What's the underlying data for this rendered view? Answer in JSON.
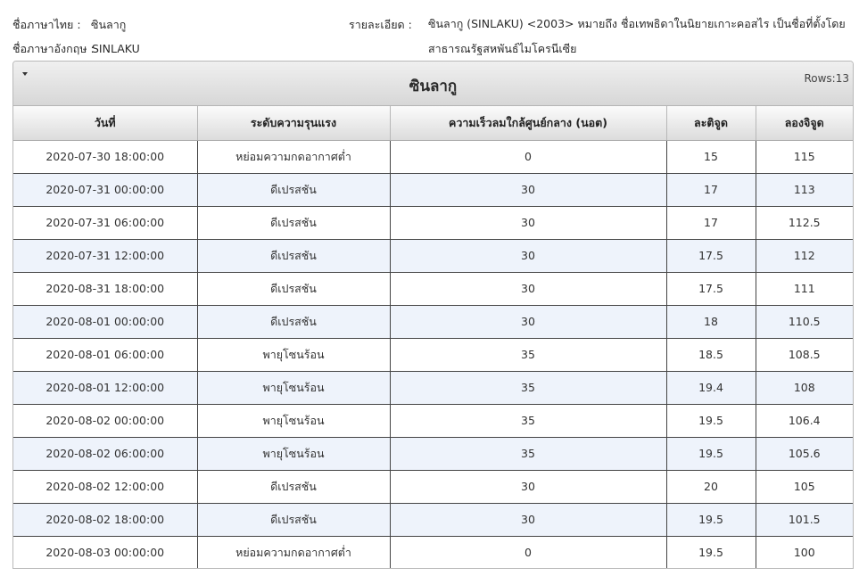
{
  "info": {
    "thai_name_label": "ชื่อภาษาไทย :",
    "thai_name_value": "ซินลากู",
    "english_name_label": "ชื่อภาษาอังกฤษ :",
    "english_name_value": "SINLAKU",
    "detail_label": "รายละเอียด :",
    "detail_value": "ซินลากู (SINLAKU) <2003> หมายถึง ชื่อเทพธิดาในนิยายเกาะคอสไร เป็นชื่อที่ตั้งโดยสาธารณรัฐสหพันธ์ไมโครนีเซีย"
  },
  "grid": {
    "caption": "ซินลากู",
    "rows_label": "Rows:13",
    "collapse_icon": "caret-down-icon",
    "columns": [
      "วันที่",
      "ระดับความรุนแรง",
      "ความเร็วลมใกล้ศูนย์กลาง (นอต)",
      "ละติจูด",
      "ลองจิจูด"
    ],
    "rows": [
      [
        "2020-07-30 18:00:00",
        "หย่อมความกดอากาศต่ำ",
        "0",
        "15",
        "115"
      ],
      [
        "2020-07-31 00:00:00",
        "ดีเปรสชัน",
        "30",
        "17",
        "113"
      ],
      [
        "2020-07-31 06:00:00",
        "ดีเปรสชัน",
        "30",
        "17",
        "112.5"
      ],
      [
        "2020-07-31 12:00:00",
        "ดีเปรสชัน",
        "30",
        "17.5",
        "112"
      ],
      [
        "2020-08-31 18:00:00",
        "ดีเปรสชัน",
        "30",
        "17.5",
        "111"
      ],
      [
        "2020-08-01 00:00:00",
        "ดีเปรสชัน",
        "30",
        "18",
        "110.5"
      ],
      [
        "2020-08-01 06:00:00",
        "พายุโซนร้อน",
        "35",
        "18.5",
        "108.5"
      ],
      [
        "2020-08-01 12:00:00",
        "พายุโซนร้อน",
        "35",
        "19.4",
        "108"
      ],
      [
        "2020-08-02 00:00:00",
        "พายุโซนร้อน",
        "35",
        "19.5",
        "106.4"
      ],
      [
        "2020-08-02 06:00:00",
        "พายุโซนร้อน",
        "35",
        "19.5",
        "105.6"
      ],
      [
        "2020-08-02 12:00:00",
        "ดีเปรสชัน",
        "30",
        "20",
        "105"
      ],
      [
        "2020-08-02 18:00:00",
        "ดีเปรสชัน",
        "30",
        "19.5",
        "101.5"
      ],
      [
        "2020-08-03 00:00:00",
        "หย่อมความกดอากาศต่ำ",
        "0",
        "19.5",
        "100"
      ]
    ]
  }
}
